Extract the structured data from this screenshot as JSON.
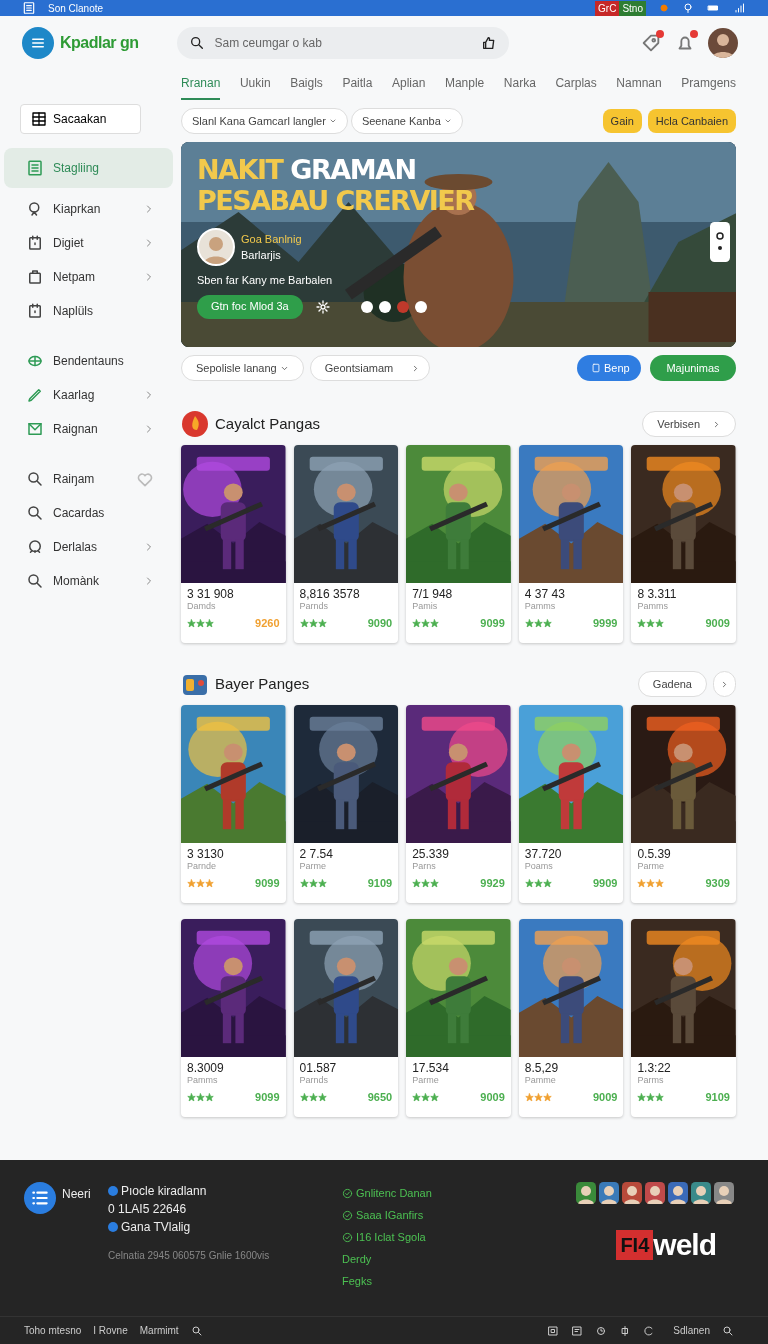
{
  "status_bar": {
    "title": "Son Clanote",
    "badges": [
      {
        "text": "GrC",
        "color": "#c62828"
      },
      {
        "text": "Stno",
        "color": "#2e7d32"
      }
    ]
  },
  "header": {
    "logo": "Kpadlar gn",
    "search": {
      "placeholder": "Sam ceumgar o kab"
    },
    "alerts": [
      {
        "unread": true
      },
      {
        "unread": true
      }
    ]
  },
  "tabs": [
    {
      "label": "Rranan",
      "selected": true
    },
    {
      "label": "Uukin",
      "selected": false
    },
    {
      "label": "Baigls",
      "selected": false
    },
    {
      "label": "Paitla",
      "selected": false
    },
    {
      "label": "Aplian",
      "selected": false
    },
    {
      "label": "Manple",
      "selected": false
    },
    {
      "label": "Narka",
      "selected": false
    },
    {
      "label": "Carplas",
      "selected": false
    },
    {
      "label": "Namnan",
      "selected": false
    },
    {
      "label": "Pramgens",
      "selected": false
    }
  ],
  "filters": [
    {
      "label": "Slanl Kana Gamcarl langler"
    },
    {
      "label": "Seenane Kanba"
    }
  ],
  "filter_actions": [
    "Gain",
    "Hcla Canbaien"
  ],
  "sidebar": {
    "button": "Sacaakan",
    "groups": [
      {
        "items": [
          {
            "label": "Stagliing",
            "chevron": false,
            "selected": true
          },
          {
            "label": "Kiaprkan",
            "chevron": true,
            "selected": false
          },
          {
            "label": "Digiet",
            "chevron": true,
            "selected": false
          },
          {
            "label": "Netpam",
            "chevron": true,
            "selected": false
          },
          {
            "label": "Naplüls",
            "chevron": false,
            "selected": false
          }
        ]
      },
      {
        "items": [
          {
            "label": "Bendentauns",
            "chevron": false,
            "selected": false
          },
          {
            "label": "Kaarlag",
            "chevron": true,
            "selected": false
          },
          {
            "label": "Raignan",
            "chevron": true,
            "selected": false
          }
        ]
      },
      {
        "items": [
          {
            "label": "Raiŋam",
            "chevron": false,
            "favorite": true,
            "selected": false
          },
          {
            "label": "Cacardas",
            "chevron": false,
            "selected": false
          },
          {
            "label": "Derlalas",
            "chevron": true,
            "selected": false
          },
          {
            "label": "Momànk",
            "chevron": true,
            "selected": false
          }
        ]
      }
    ]
  },
  "hero": {
    "title": [
      [
        {
          "text": "NAKIT",
          "color": "#f2c94c"
        },
        {
          "text": "GRAMAN",
          "color": "#ffffff"
        }
      ],
      [
        {
          "text": "PESABAU CRERVIER",
          "color": "#f2c94c"
        }
      ]
    ],
    "author": "Goa Banlnig",
    "author_sub": "Barlarjis",
    "caption": "Sben far Kany me Barbalen",
    "cta": "Gtn foc Mlod 3a",
    "dots": [
      {
        "selected": false
      },
      {
        "selected": false
      },
      {
        "selected": true
      },
      {
        "selected": false
      }
    ]
  },
  "actions": [
    {
      "label": "Sepolisle lanang",
      "kind": "dropdown"
    },
    {
      "label": "Geontsiamam",
      "kind": "link"
    },
    {
      "label": "Benp",
      "kind": "primary"
    },
    {
      "label": "Majunimas",
      "kind": "success"
    }
  ],
  "sections": [
    {
      "title": "Cayalct Pangas",
      "more": "Verbisen",
      "cards": [
        {
          "number": "3 31 908",
          "subtitle": "Damds",
          "stars": 3,
          "color": "#4caf50",
          "price": {
            "text": "9260",
            "color": "#f0a030"
          }
        },
        {
          "number": "8,816 3578",
          "subtitle": "Parnds",
          "stars": 3,
          "color": "#4caf50",
          "price": {
            "text": "9090",
            "color": "#4caf50"
          }
        },
        {
          "number": "7/1 948",
          "subtitle": "Pamis",
          "stars": 3,
          "color": "#4caf50",
          "price": {
            "text": "9099",
            "color": "#4caf50"
          }
        },
        {
          "number": "4 37 43",
          "subtitle": "Pamms",
          "stars": 3,
          "color": "#4caf50",
          "price": {
            "text": "9999",
            "color": "#4caf50"
          }
        },
        {
          "number": "8 3.311",
          "subtitle": "Pamms",
          "stars": 3,
          "color": "#4caf50",
          "price": {
            "text": "9009",
            "color": "#4caf50"
          }
        }
      ]
    },
    {
      "title": "Bayer Panges",
      "more": "Gadena",
      "cards": [
        {
          "number": "3 3130",
          "subtitle": "Parnde",
          "stars": 3,
          "color": "#f0a030",
          "price": {
            "text": "9099",
            "color": "#4caf50"
          }
        },
        {
          "number": "2 7.54",
          "subtitle": "Parme",
          "stars": 3,
          "color": "#4caf50",
          "price": {
            "text": "9109",
            "color": "#4caf50"
          }
        },
        {
          "number": "25.339",
          "subtitle": "Parns",
          "stars": 3,
          "color": "#4caf50",
          "price": {
            "text": "9929",
            "color": "#4caf50"
          }
        },
        {
          "number": "37.720",
          "subtitle": "Poams",
          "stars": 3,
          "color": "#4caf50",
          "price": {
            "text": "9909",
            "color": "#4caf50"
          }
        },
        {
          "number": "0.5.39",
          "subtitle": "Parme",
          "stars": 3,
          "color": "#f0a030",
          "price": {
            "text": "9309",
            "color": "#4caf50"
          }
        },
        {
          "number": "8.3009",
          "subtitle": "Pamms",
          "stars": 3,
          "color": "#4caf50",
          "price": {
            "text": "9099",
            "color": "#4caf50"
          }
        },
        {
          "number": "01.587",
          "subtitle": "Parnds",
          "stars": 3,
          "color": "#4caf50",
          "price": {
            "text": "9650",
            "color": "#4caf50"
          }
        },
        {
          "number": "17.534",
          "subtitle": "Parme",
          "stars": 3,
          "color": "#4caf50",
          "price": {
            "text": "9009",
            "color": "#4caf50"
          }
        },
        {
          "number": "8.5,29",
          "subtitle": "Pamme",
          "stars": 3,
          "color": "#f0a030",
          "price": {
            "text": "9009",
            "color": "#4caf50"
          }
        },
        {
          "number": "1.3:22",
          "subtitle": "Parms",
          "stars": 3,
          "color": "#4caf50",
          "price": {
            "text": "9109",
            "color": "#4caf50"
          }
        }
      ]
    }
  ],
  "footer": {
    "brand": "Neeri",
    "contact": [
      {
        "text": "Pıocle kiradlann",
        "kind": "dot"
      },
      {
        "text": "0 1LAI5 22646",
        "kind": "plain"
      },
      {
        "text": "Gana TVlalig",
        "kind": "dot"
      }
    ],
    "note": "Celnatia 2945 060575 Gnlie 1600vis",
    "links": [
      {
        "text": "Gnlitenc Danan",
        "kind": "icon"
      },
      {
        "text": "Saaa IGanfirs",
        "kind": "icon"
      },
      {
        "text": "I16 Iclat Sgola",
        "kind": "icon"
      },
      {
        "text": "Derdy",
        "kind": "plain"
      },
      {
        "text": "Fegks",
        "kind": "plain"
      }
    ],
    "logo": {
      "mark": "FI4",
      "word": "weld"
    },
    "bottom_links": [
      "Toho mtesno",
      "I Rovne",
      "Marmimt"
    ],
    "bottom_right": "Sdlanen"
  }
}
